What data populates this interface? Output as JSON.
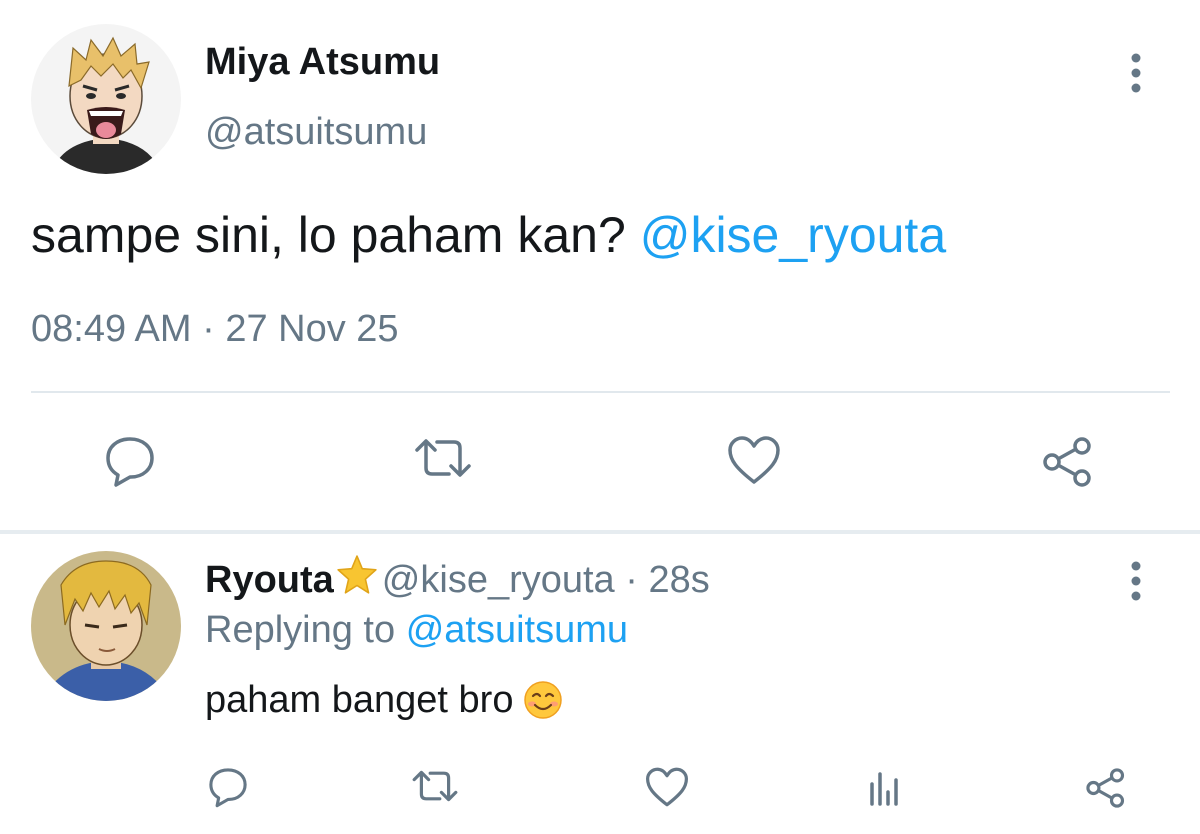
{
  "main_tweet": {
    "display_name": "Miya Atsumu",
    "handle": "@atsuitsumu",
    "text": "sampe sini, lo paham kan?",
    "mention": "@kise_ryouta",
    "time": "08:49 AM",
    "separator": " · ",
    "date": "27 Nov 25",
    "avatar_icon": "anime-avatar-blond-grinning",
    "actions": [
      "reply-icon",
      "retweet-icon",
      "like-icon",
      "share-icon"
    ]
  },
  "reply_tweet": {
    "display_name": "Ryouta",
    "badge_icon": "star-emoji",
    "handle": "@kise_ryouta",
    "separator": " · ",
    "age": "28s",
    "replying_label": "Replying to",
    "replying_handle": "@atsuitsumu",
    "text": "paham banget bro",
    "emoji_icon": "smiling-face-emoji",
    "avatar_icon": "anime-avatar-blond-calm",
    "actions": [
      "reply-icon",
      "retweet-icon",
      "like-icon",
      "stats-icon",
      "share-icon"
    ]
  },
  "colors": {
    "text": "#14171a",
    "secondary": "#657786",
    "link": "#1da1f2",
    "divider": "#e1e8ed"
  }
}
